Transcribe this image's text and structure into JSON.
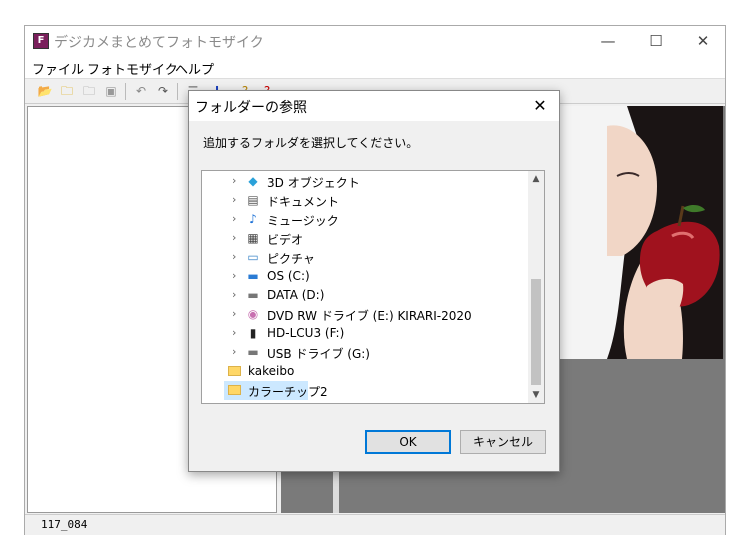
{
  "app": {
    "title": "デジカメまとめてフォトモザイク",
    "icon_letter": "F",
    "menu": [
      "ファイル",
      "フォトモザイク",
      "ヘルプ"
    ],
    "window_controls": {
      "minimize": "—",
      "maximize": "☐",
      "close": "✕"
    },
    "status": "117_084"
  },
  "dialog": {
    "title": "フォルダーの参照",
    "close": "✕",
    "instruction": "追加するフォルダを選択してください。",
    "tree": [
      {
        "label": "3D オブジェクト",
        "icon": "3d-objects-icon",
        "expandable": true
      },
      {
        "label": "ドキュメント",
        "icon": "documents-icon",
        "expandable": true
      },
      {
        "label": "ミュージック",
        "icon": "music-icon",
        "expandable": true
      },
      {
        "label": "ビデオ",
        "icon": "video-icon",
        "expandable": true
      },
      {
        "label": "ピクチャ",
        "icon": "pictures-icon",
        "expandable": true
      },
      {
        "label": "OS (C:)",
        "icon": "system-drive-icon",
        "expandable": true
      },
      {
        "label": "DATA (D:)",
        "icon": "drive-icon",
        "expandable": true
      },
      {
        "label": "DVD RW ドライブ (E:) KIRARI-2020",
        "icon": "dvd-drive-icon",
        "expandable": true
      },
      {
        "label": "HD-LCU3 (F:)",
        "icon": "external-drive-icon",
        "expandable": true
      },
      {
        "label": "USB ドライブ (G:)",
        "icon": "usb-drive-icon",
        "expandable": true
      },
      {
        "label": "kakeibo",
        "icon": "folder-icon",
        "expandable": false
      },
      {
        "label": "カラーチップ2",
        "icon": "folder-icon",
        "expandable": false,
        "selected": true
      }
    ],
    "ok": "OK",
    "cancel": "キャンセル",
    "selection_color": "#cce8ff",
    "accent": "#0078d7"
  }
}
